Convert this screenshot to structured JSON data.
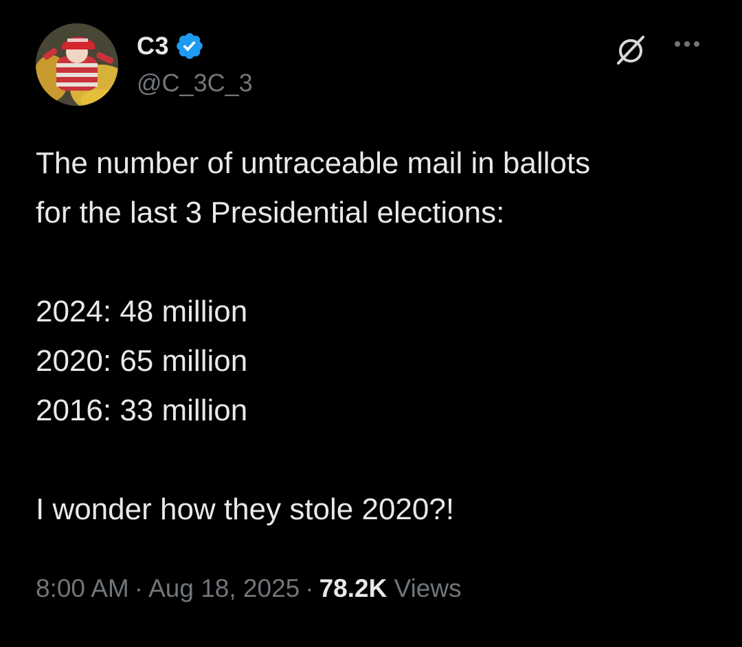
{
  "tweet": {
    "author": {
      "display_name": "C3",
      "handle": "@C_3C_3",
      "verified": true,
      "verified_color": "#1d9bf0",
      "avatar_icon": "user-avatar-photo"
    },
    "actions": {
      "grok_icon": "grok-icon",
      "more_icon": "more-options-icon"
    },
    "text": {
      "line1": "The number of untraceable mail in ballots",
      "line2": "for the last 3 Presidential elections:",
      "stats": [
        "2024: 48 million",
        "2020: 65 million",
        "2016: 33 million"
      ],
      "closing": "I wonder how they stole 2020?!"
    },
    "meta": {
      "time": "8:00 AM",
      "separator": "·",
      "date": "Aug 18, 2025",
      "views_count": "78.2K",
      "views_label": "Views"
    }
  },
  "colors": {
    "background": "#000000",
    "primary_text": "#e7e9ea",
    "secondary_text": "#71767b",
    "accent": "#1d9bf0"
  }
}
